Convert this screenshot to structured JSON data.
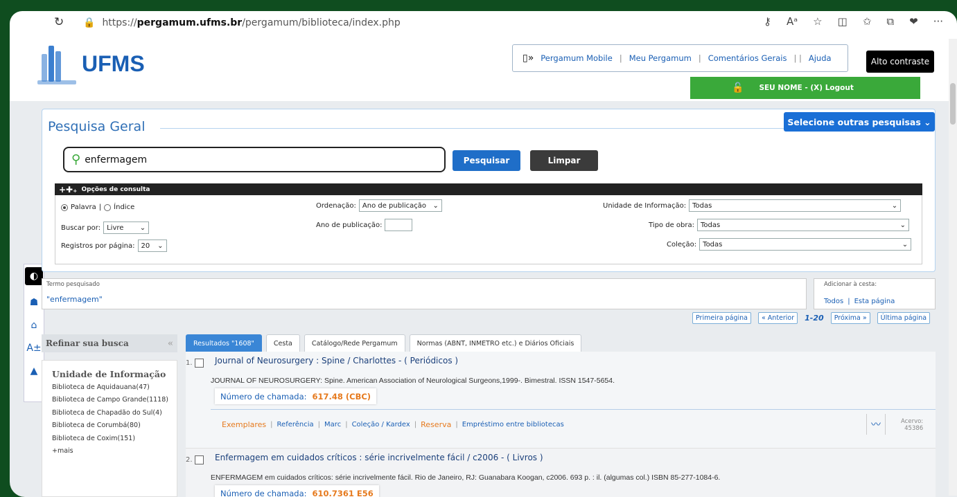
{
  "browser": {
    "url_prefix": "https://",
    "url_domain": "pergamum.ufms.br",
    "url_path": "/pergamum/biblioteca/index.php"
  },
  "header": {
    "logo_text": "UFMS",
    "nav": {
      "mobile": "Pergamum Mobile",
      "meu": "Meu Pergamum",
      "comentarios": "Comentários Gerais",
      "ajuda": "Ajuda"
    },
    "contrast_label": "Alto contraste",
    "logout_label": "SEU NOME - (X) Logout"
  },
  "search": {
    "title": "Pesquisa Geral",
    "select_other": "Selecione outras pesquisas",
    "query": "enfermagem",
    "btn_search": "Pesquisar",
    "btn_clear": "Limpar",
    "options_title": "Opções de consulta",
    "radio_palavra": "Palavra",
    "radio_indice": "Índice",
    "buscar_por_label": "Buscar por:",
    "buscar_por_value": "Livre",
    "registros_label": "Registros por página:",
    "registros_value": "20",
    "ordenacao_label": "Ordenação:",
    "ordenacao_value": "Ano de publicação",
    "ano_label": "Ano de publicação:",
    "unidade_label": "Unidade de Informação:",
    "unidade_value": "Todas",
    "tipo_label": "Tipo de obra:",
    "tipo_value": "Todas",
    "colecao_label": "Coleção:",
    "colecao_value": "Todas"
  },
  "termo": {
    "label": "Termo pesquisado",
    "value": "\"enfermagem\""
  },
  "cesta": {
    "label": "Adicionar à cesta:",
    "todos": "Todos",
    "esta": "Esta página"
  },
  "pager": {
    "first": "Primeira página",
    "prev": "« Anterior",
    "current": "1-20",
    "next": "Próxima »",
    "last": "Última página"
  },
  "refine": {
    "header": "Refinar sua busca",
    "section_title": "Unidade de Informação",
    "items": [
      "Biblioteca de Aquidauana(47)",
      "Biblioteca de Campo Grande(1118)",
      "Biblioteca de Chapadão do Sul(4)",
      "Biblioteca de Corumbá(80)",
      "Biblioteca de Coxim(151)",
      "+mais"
    ]
  },
  "tabs": [
    "Resultados \"1608\"",
    "Cesta",
    "Catálogo/Rede Pergamum",
    "Normas (ABNT, INMETRO etc.) e Diários Oficiais"
  ],
  "results": [
    {
      "num": "1.",
      "title": "Journal of Neurosurgery : Spine / Charlottes - ( Periódicos )",
      "desc": "JOURNAL OF NEUROSURGERY: Spine. American Association of Neurological Surgeons,1999-. Bimestral. ISSN 1547-5654.",
      "call_label": "Número de chamada:",
      "call_value": "617.48 (CBC)",
      "actions": {
        "exemplares": "Exemplares",
        "referencia": "Referência",
        "marc": "Marc",
        "colecao": "Coleção / Kardex",
        "reserva": "Reserva",
        "emprestimo": "Empréstimo entre bibliotecas"
      },
      "acervo_label": "Acervo:",
      "acervo_value": "45386"
    },
    {
      "num": "2.",
      "title": "Enfermagem em cuidados críticos : série incrivelmente fácil / c2006 - ( Livros )",
      "desc": "ENFERMAGEM em cuidados críticos: série incrivelmente fácil. Rio de Janeiro, RJ: Guanabara Koogan, c2006. 693 p. : il. (algumas col.) ISBN 85-277-1084-6.",
      "call_label": "Número de chamada:",
      "call_value": "610.7361 E56"
    }
  ]
}
